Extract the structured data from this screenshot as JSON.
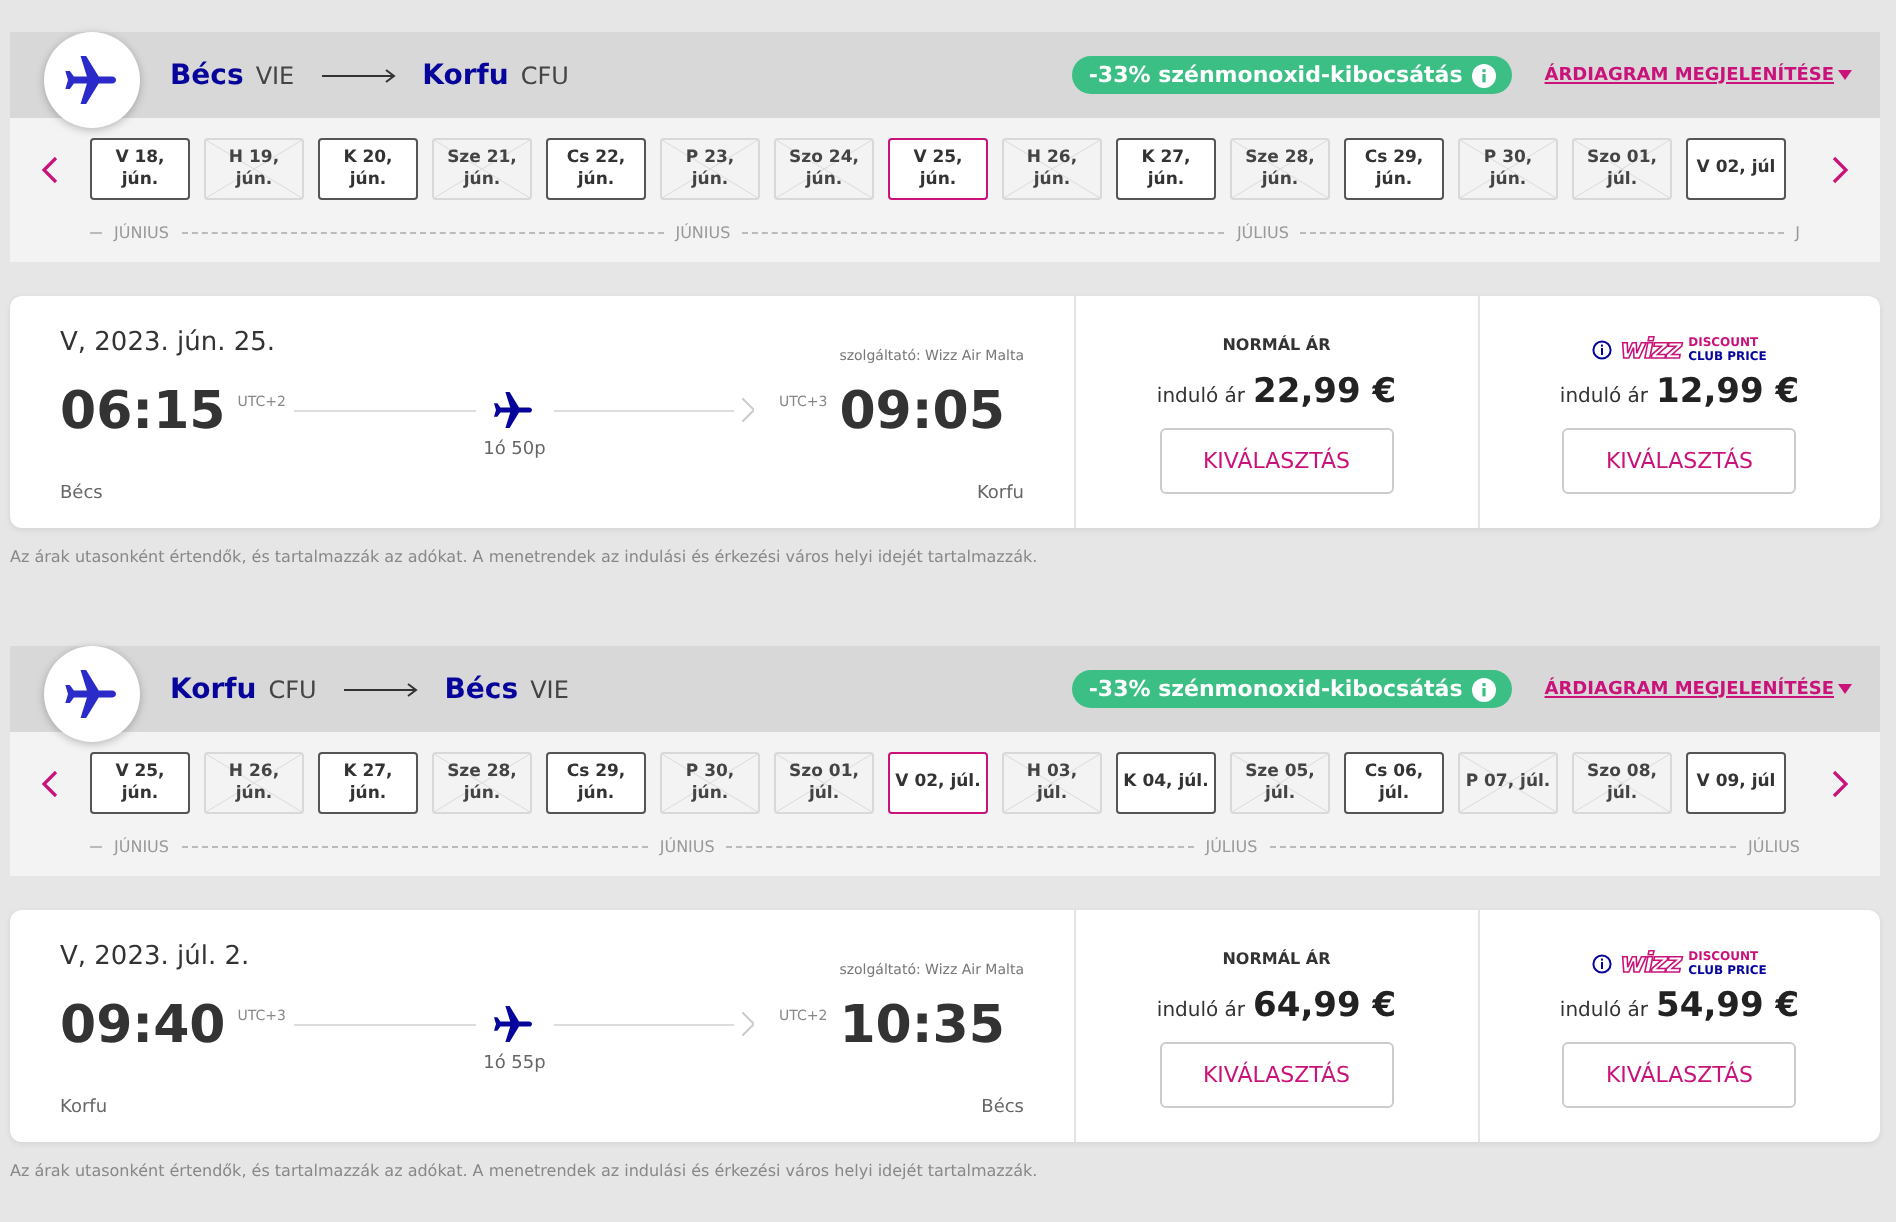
{
  "legs": [
    {
      "from": {
        "city": "Bécs",
        "code": "VIE"
      },
      "to": {
        "city": "Korfu",
        "code": "CFU"
      },
      "co2_badge": "-33% szénmonoxid-kibocsátás",
      "chart_link": "ÁRDIAGRAM MEGJELENÍTÉSE",
      "dates": [
        {
          "day": "V 18,",
          "month": "jún.",
          "available": true,
          "selected": false
        },
        {
          "day": "H 19,",
          "month": "jún.",
          "available": false,
          "selected": false
        },
        {
          "day": "K 20,",
          "month": "jún.",
          "available": true,
          "selected": false
        },
        {
          "day": "Sze 21,",
          "month": "jún.",
          "available": false,
          "selected": false
        },
        {
          "day": "Cs 22,",
          "month": "jún.",
          "available": true,
          "selected": false
        },
        {
          "day": "P 23,",
          "month": "jún.",
          "available": false,
          "selected": false
        },
        {
          "day": "Szo 24,",
          "month": "jún.",
          "available": false,
          "selected": false
        },
        {
          "day": "V 25,",
          "month": "jún.",
          "available": true,
          "selected": true
        },
        {
          "day": "H 26,",
          "month": "jún.",
          "available": false,
          "selected": false
        },
        {
          "day": "K 27,",
          "month": "jún.",
          "available": true,
          "selected": false
        },
        {
          "day": "Sze 28,",
          "month": "jún.",
          "available": false,
          "selected": false
        },
        {
          "day": "Cs 29,",
          "month": "jún.",
          "available": true,
          "selected": false
        },
        {
          "day": "P 30,",
          "month": "jún.",
          "available": false,
          "selected": false
        },
        {
          "day": "Szo 01,",
          "month": "júl.",
          "available": false,
          "selected": false
        },
        {
          "day": "V 02, júl",
          "available": true,
          "selected": false
        }
      ],
      "months": [
        "JÚNIUS",
        "JÚNIUS",
        "JÚLIUS",
        "J"
      ],
      "flight": {
        "date": "V, 2023. jún. 25.",
        "operator": "szolgáltató: Wizz Air Malta",
        "dep_time": "06:15",
        "dep_utc": "UTC+2",
        "dep_city": "Bécs",
        "duration": "1ó 50p",
        "arr_utc": "UTC+3",
        "arr_time": "09:05",
        "arr_city": "Korfu"
      },
      "fares": [
        {
          "kind": "normal",
          "title": "NORMÁL ÁR",
          "from_label": "induló ár",
          "price": "22,99 €",
          "button": "KIVÁLASZTÁS"
        },
        {
          "kind": "club",
          "logo": "wizz",
          "logo_line1": "DISCOUNT",
          "logo_line2": "CLUB PRICE",
          "from_label": "induló ár",
          "price": "12,99 €",
          "button": "KIVÁLASZTÁS"
        }
      ],
      "note": "Az árak utasonként értendők, és tartalmazzák az adókat. A menetrendek az indulási és érkezési város helyi idejét tartalmazzák."
    },
    {
      "from": {
        "city": "Korfu",
        "code": "CFU"
      },
      "to": {
        "city": "Bécs",
        "code": "VIE"
      },
      "co2_badge": "-33% szénmonoxid-kibocsátás",
      "chart_link": "ÁRDIAGRAM MEGJELENÍTÉSE",
      "dates": [
        {
          "day": "V 25,",
          "month": "jún.",
          "available": true,
          "selected": false
        },
        {
          "day": "H 26,",
          "month": "jún.",
          "available": false,
          "selected": false
        },
        {
          "day": "K 27,",
          "month": "jún.",
          "available": true,
          "selected": false
        },
        {
          "day": "Sze 28,",
          "month": "jún.",
          "available": false,
          "selected": false
        },
        {
          "day": "Cs 29,",
          "month": "jún.",
          "available": true,
          "selected": false
        },
        {
          "day": "P 30,",
          "month": "jún.",
          "available": false,
          "selected": false
        },
        {
          "day": "Szo 01,",
          "month": "júl.",
          "available": false,
          "selected": false
        },
        {
          "day": "V 02, júl.",
          "available": true,
          "selected": true
        },
        {
          "day": "H 03,",
          "month": "júl.",
          "available": false,
          "selected": false
        },
        {
          "day": "K 04, júl.",
          "available": true,
          "selected": false
        },
        {
          "day": "Sze 05,",
          "month": "júl.",
          "available": false,
          "selected": false
        },
        {
          "day": "Cs 06,",
          "month": "júl.",
          "available": true,
          "selected": false
        },
        {
          "day": "P 07, júl.",
          "available": false,
          "selected": false
        },
        {
          "day": "Szo 08,",
          "month": "júl.",
          "available": false,
          "selected": false
        },
        {
          "day": "V 09, júl",
          "available": true,
          "selected": false
        }
      ],
      "months": [
        "JÚNIUS",
        "JÚNIUS",
        "JÚLIUS",
        "JÚLIUS"
      ],
      "flight": {
        "date": "V, 2023. júl. 2.",
        "operator": "szolgáltató: Wizz Air Malta",
        "dep_time": "09:40",
        "dep_utc": "UTC+3",
        "dep_city": "Korfu",
        "duration": "1ó 55p",
        "arr_utc": "UTC+2",
        "arr_time": "10:35",
        "arr_city": "Bécs"
      },
      "fares": [
        {
          "kind": "normal",
          "title": "NORMÁL ÁR",
          "from_label": "induló ár",
          "price": "64,99 €",
          "button": "KIVÁLASZTÁS"
        },
        {
          "kind": "club",
          "logo": "wizz",
          "logo_line1": "DISCOUNT",
          "logo_line2": "CLUB PRICE",
          "from_label": "induló ár",
          "price": "54,99 €",
          "button": "KIVÁLASZTÁS"
        }
      ],
      "note": "Az árak utasonként értendők, és tartalmazzák az adókat. A menetrendek az indulási és érkezési város helyi idejét tartalmazzák."
    }
  ]
}
